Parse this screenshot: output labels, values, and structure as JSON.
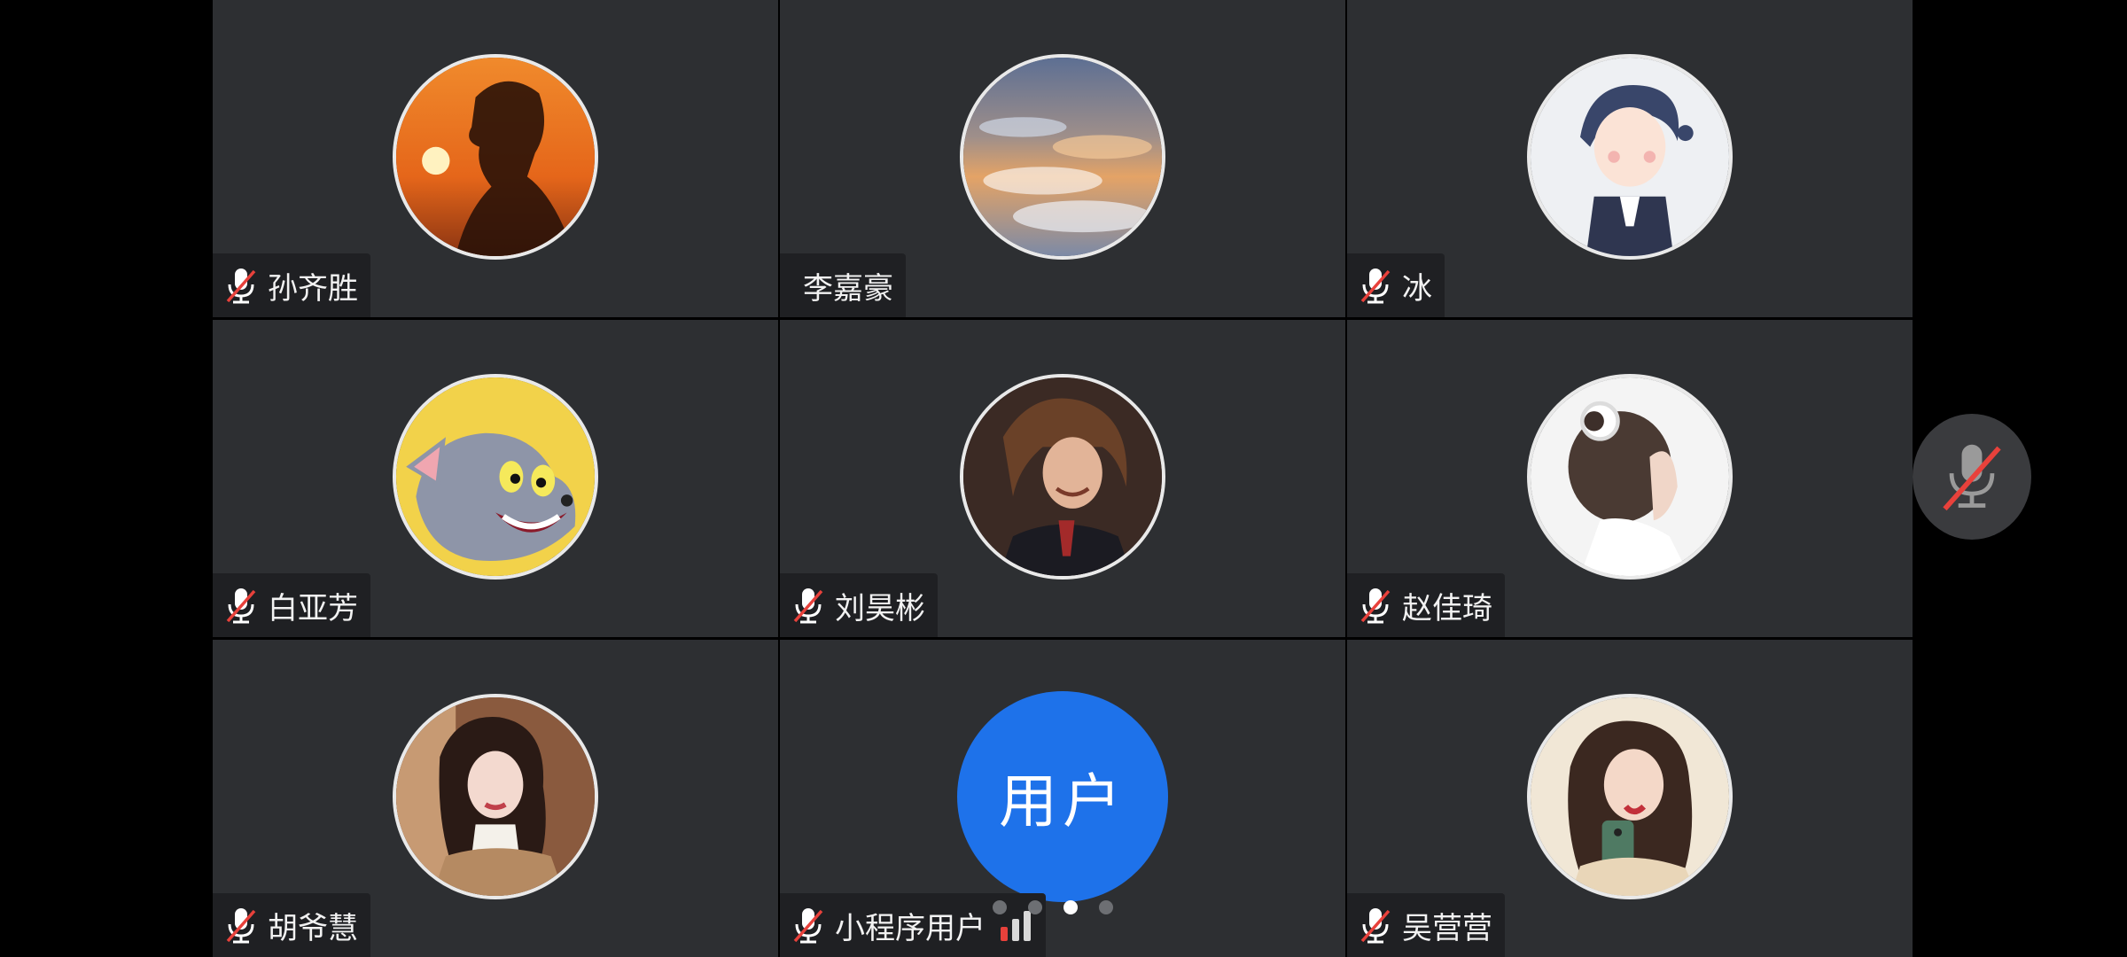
{
  "colors": {
    "background": "#000000",
    "tile_background": "#2d2f32",
    "name_tag_background": "#1f2023",
    "muted_slash": "#e8413b",
    "text_avatar_background": "#1e72ea",
    "active_dot": "#ffffff",
    "inactive_dot": "#6d6f73"
  },
  "participants": [
    {
      "name": "孙齐胜",
      "muted": true,
      "avatar": "sunset-silhouette-photo"
    },
    {
      "name": "李嘉豪",
      "muted": false,
      "avatar": "sky-clouds-photo"
    },
    {
      "name": "冰",
      "muted": true,
      "avatar": "cartoon-girl-illustration"
    },
    {
      "name": "白亚芳",
      "muted": true,
      "avatar": "cartoon-cat-photo"
    },
    {
      "name": "刘昊彬",
      "muted": true,
      "avatar": "portrait-photo"
    },
    {
      "name": "赵佳琦",
      "muted": true,
      "avatar": "girl-back-photo"
    },
    {
      "name": "胡爷慧",
      "muted": true,
      "avatar": "woman-portrait-photo"
    },
    {
      "name": "小程序用户",
      "muted": true,
      "avatar_text": "用户",
      "signal": "signal-bars-icon"
    },
    {
      "name": "吴营营",
      "muted": true,
      "avatar": "girl-selfie-photo"
    }
  ],
  "pagination": {
    "total_pages": 4,
    "current_page": 3
  },
  "controls": {
    "mic_toggle_icon": "mic-muted-icon",
    "mic_state": "muted"
  }
}
